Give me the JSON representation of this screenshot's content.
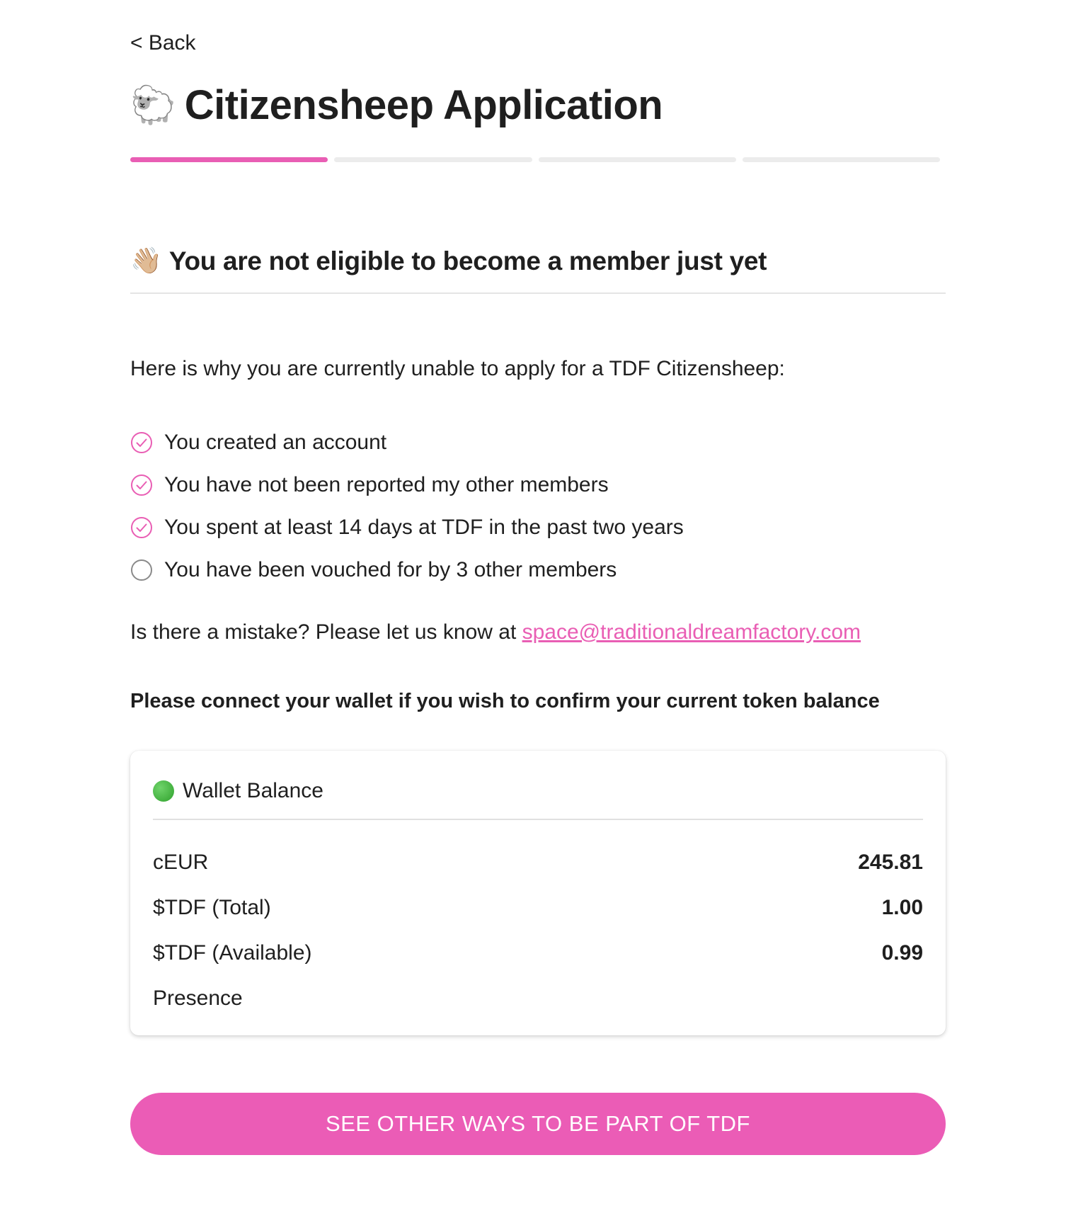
{
  "nav": {
    "back_label": "< Back"
  },
  "header": {
    "title_emoji": "🐑",
    "title": "Citizensheep Application",
    "progress": {
      "total_steps": 4,
      "current_step": 1,
      "active_color": "#e95eb4",
      "inactive_color": "#ececec"
    }
  },
  "eligibility": {
    "heading_emoji": "👋🏼",
    "heading": "You are not eligible to become a member just yet",
    "intro": "Here is why you are currently unable to apply for a TDF Citizensheep:",
    "criteria": [
      {
        "label": "You created an account",
        "met": true,
        "icon": "check-circle-icon"
      },
      {
        "label": "You have not been reported my other members",
        "met": true,
        "icon": "check-circle-icon"
      },
      {
        "label": "You spent at least 14 days at TDF in the past two years",
        "met": true,
        "icon": "check-circle-icon"
      },
      {
        "label": "You have been vouched for by 3 other members",
        "met": false,
        "icon": "empty-circle-icon"
      }
    ],
    "contact_text": "Is there a mistake? Please let us know at ",
    "contact_email": "space@traditionaldreamfactory.com"
  },
  "wallet": {
    "prompt": "Please connect your wallet if you wish to confirm your current token balance",
    "status_icon": "green-circle-icon",
    "status_color": "#2fa12c",
    "title": "Wallet Balance",
    "rows": [
      {
        "label": "cEUR",
        "value": "245.81"
      },
      {
        "label": "$TDF (Total)",
        "value": "1.00"
      },
      {
        "label": "$TDF (Available)",
        "value": "0.99"
      },
      {
        "label": "Presence",
        "value": ""
      }
    ]
  },
  "cta": {
    "label": "SEE OTHER WAYS TO BE PART OF TDF",
    "color": "#eb5cb6"
  }
}
